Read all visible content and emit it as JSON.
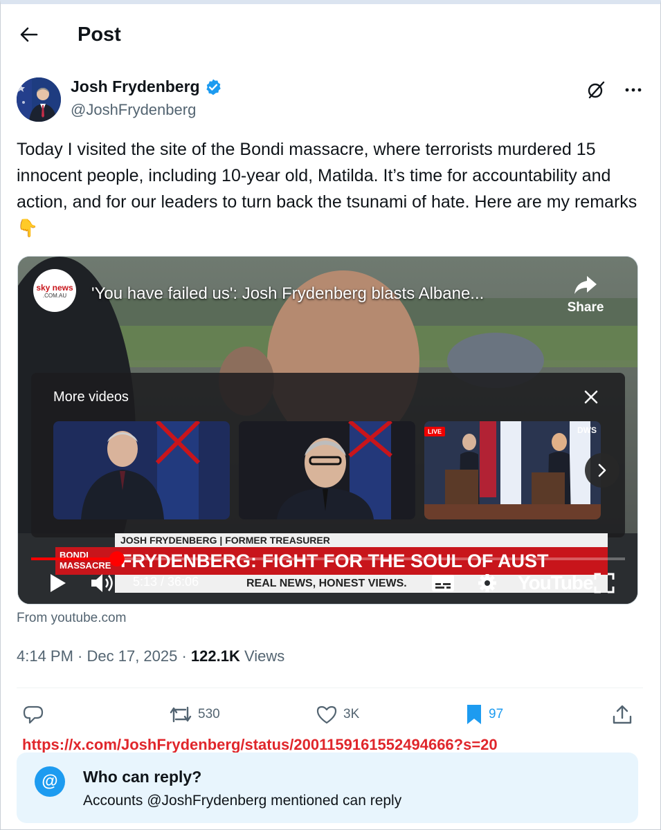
{
  "header": {
    "title": "Post",
    "back_icon": "arrow-left-icon"
  },
  "author": {
    "display_name": "Josh Frydenberg",
    "handle": "@JoshFrydenberg",
    "verified": true,
    "verified_color": "#1d9bf0"
  },
  "tweet": {
    "text": "Today I visited the site of the Bondi massacre, where terrorists murdered 15 innocent people, including 10-year old, Matilda. It’s time for accountability and action, and for our leaders to turn back the tsunami of hate. Here are my remarks👇"
  },
  "video": {
    "channel_logo_top": "sky news",
    "channel_logo_bottom": ".COM.AU",
    "title": "'You have failed us': Josh Frydenberg blasts Albane...",
    "share_label": "Share",
    "more_videos_title": "More videos",
    "thumb_live_badge": "LIVE",
    "thumb_brand": "DWS",
    "lower_third_name": "JOSH FRYDENBERG | FORMER TREASURER",
    "lower_third_headline": "FRYDENBERG: FIGHT FOR THE SOUL OF AUST",
    "lower_third_tag_left": "BONDI MASSACRE",
    "lower_third_tag": "REAL NEWS, HONEST VIEWS.",
    "time": "5:13 / 36:06",
    "progress": 0.144,
    "youtube_label": "YouTube",
    "accent": "#ff0000"
  },
  "source": "From youtube.com",
  "meta": {
    "time": "4:14 PM · Dec 17, 2025 · ",
    "views": "122.1K",
    "views_label": " Views"
  },
  "actions": {
    "reply": {
      "icon": "reply-icon"
    },
    "repost": {
      "icon": "repost-icon",
      "count": "530"
    },
    "like": {
      "icon": "heart-icon",
      "count": "3K"
    },
    "bookmark": {
      "icon": "bookmark-icon",
      "count": "97",
      "color": "#1d9bf0"
    },
    "share": {
      "icon": "share-icon"
    }
  },
  "url_note": "https://x.com/JoshFrydenberg/status/2001159161552494666?s=20",
  "who_can_reply": {
    "title": "Who can reply?",
    "subtitle": "Accounts @JoshFrydenberg mentioned can reply",
    "badge": "@"
  }
}
